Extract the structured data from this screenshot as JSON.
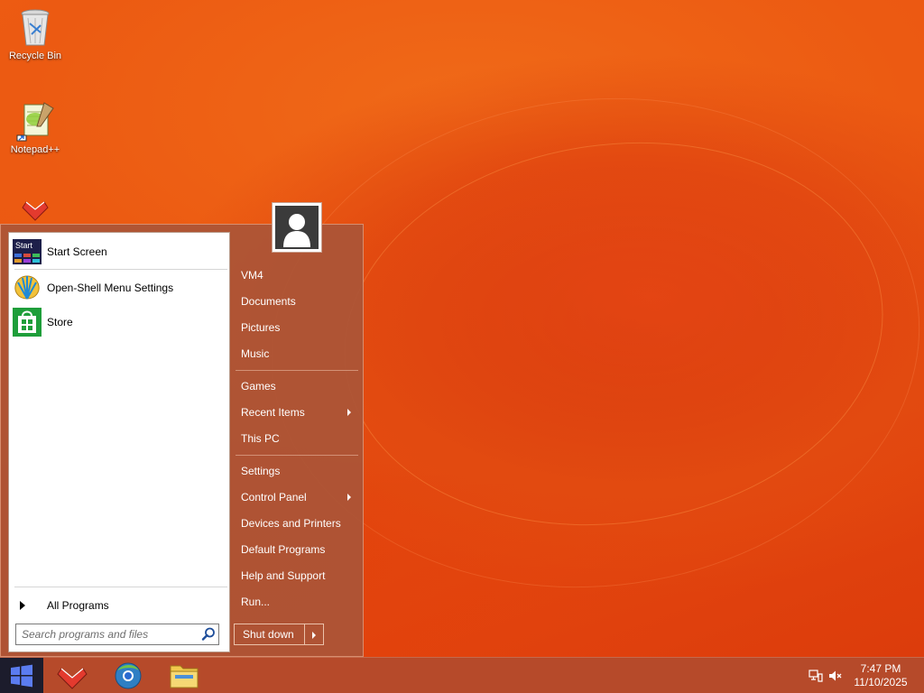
{
  "desktop": {
    "icons": [
      {
        "label": "Recycle Bin",
        "icon": "recycle-bin-icon"
      },
      {
        "label": "Notepad++",
        "icon": "notepad-plus-plus-icon"
      },
      {
        "label": "",
        "icon": "app-icon"
      }
    ]
  },
  "start_menu": {
    "programs": [
      {
        "label": "Start Screen",
        "icon": "start-screen-icon",
        "icon_text": "Start"
      },
      {
        "label": "Open-Shell Menu Settings",
        "icon": "open-shell-icon"
      },
      {
        "label": "Store",
        "icon": "store-icon"
      }
    ],
    "all_programs_label": "All Programs",
    "search_placeholder": "Search programs and files",
    "right_items": [
      {
        "label": "VM4"
      },
      {
        "label": "Documents"
      },
      {
        "label": "Pictures"
      },
      {
        "label": "Music"
      },
      {
        "label": "Games"
      },
      {
        "label": "Recent Items",
        "submenu": true
      },
      {
        "label": "This PC"
      },
      {
        "label": "Settings"
      },
      {
        "label": "Control Panel",
        "submenu": true
      },
      {
        "label": "Devices and Printers"
      },
      {
        "label": "Default Programs"
      },
      {
        "label": "Help and Support"
      },
      {
        "label": "Run..."
      }
    ],
    "shutdown_label": "Shut down"
  },
  "taskbar": {
    "apps": [
      "app-icon",
      "browser-icon",
      "file-explorer-icon"
    ],
    "tray_icons": [
      "network-icon",
      "volume-muted-icon"
    ],
    "clock": {
      "time": "7:47 PM",
      "date": "11/10/2025"
    }
  },
  "colors": {
    "desktop_orange": "#e8470f",
    "start_menu_bg": "#aa5537",
    "taskbar_bg": "#b64a2a",
    "start_button_bg": "#1c1c2c"
  }
}
